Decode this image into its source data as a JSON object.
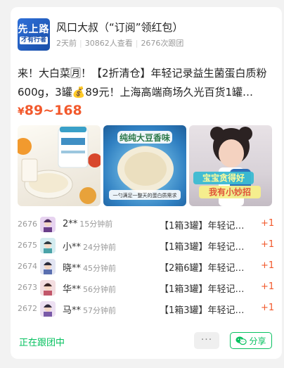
{
  "account": {
    "avatar_text_line1": "先上路",
    "avatar_text_line2": "才有行者",
    "name": "风口大叔（“订阅”领红包）",
    "posted": "2天前",
    "views": "30862人查看",
    "follows": "2676次跟团"
  },
  "post": {
    "title": "来！大白菜🈷！【2折清仓】年轻记录益生菌蛋白质粉600g，3罐💰89元！上海高端商场久光百货1罐…",
    "price_symbol": "¥",
    "price": "89~168"
  },
  "images": [
    {
      "label": "product-photo-milk-powder"
    },
    {
      "label": "product-photo-bean-powder-scoop",
      "overlay_top": "纯纯大豆香味",
      "overlay_bottom": "一勺满足一整天的蛋白质需求"
    },
    {
      "label": "product-photo-child-drinking",
      "overlay_1": "宝宝贪得好",
      "overlay_2": "我有小妙招"
    }
  ],
  "orders": [
    {
      "num": "2676",
      "name": "2**",
      "time": "15分钟前",
      "product": "【1箱3罐】年轻记…",
      "qty": "+1"
    },
    {
      "num": "2675",
      "name": "小**",
      "time": "24分钟前",
      "product": "【1箱3罐】年轻记…",
      "qty": "+1"
    },
    {
      "num": "2674",
      "name": "晓**",
      "time": "45分钟前",
      "product": "【2箱6罐】年轻记…",
      "qty": "+1"
    },
    {
      "num": "2673",
      "name": "华**",
      "time": "56分钟前",
      "product": "【1箱3罐】年轻记…",
      "qty": "+1"
    },
    {
      "num": "2672",
      "name": "马**",
      "time": "57分钟前",
      "product": "【1箱3罐】年轻记…",
      "qty": "+1"
    }
  ],
  "footer": {
    "status": "正在跟团中",
    "more": "···",
    "share": "分享"
  },
  "colors": {
    "accent_price": "#f2592c",
    "wechat_green": "#07c160"
  }
}
